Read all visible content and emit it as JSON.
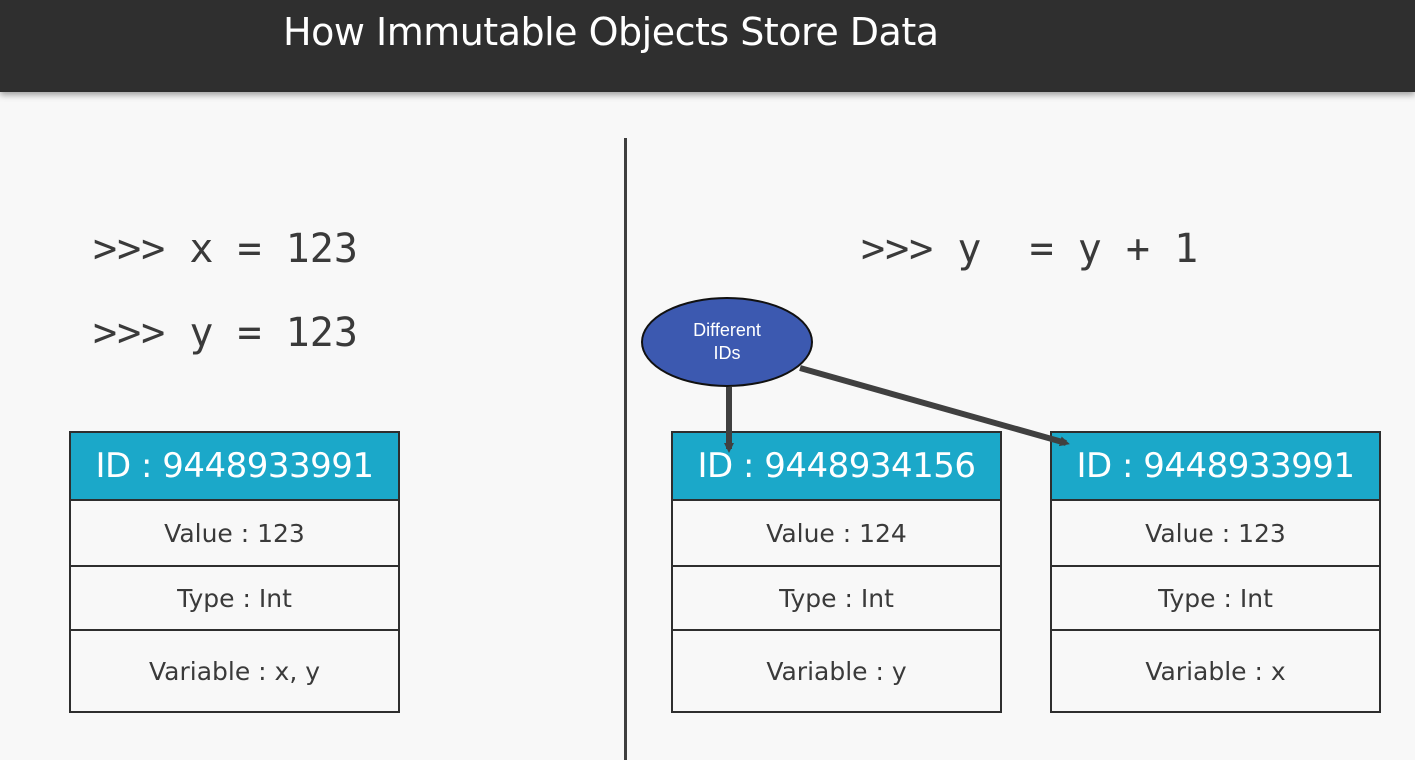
{
  "title": "How Immutable Objects Store Data",
  "left_panel": {
    "code_lines": [
      ">>> x = 123",
      ">>> y = 123"
    ],
    "object": {
      "id": "ID : 9448933991",
      "value": "Value : 123",
      "type": "Type : Int",
      "variable": "Variable : x, y"
    }
  },
  "right_panel": {
    "code_line": ">>> y  = y + 1",
    "callout": {
      "line1": "Different",
      "line2": "IDs",
      "fill_color": "#3c59b0",
      "stroke_color": "#111111"
    },
    "objects": [
      {
        "id": "ID : 9448934156",
        "value": "Value : 124",
        "type": "Type : Int",
        "variable": "Variable : y"
      },
      {
        "id": "ID : 9448933991",
        "value": "Value : 123",
        "type": "Type : Int",
        "variable": "Variable : x"
      }
    ]
  },
  "colors": {
    "header_bg": "#2f2f2f",
    "id_bar": "#1ba8c9",
    "arrow": "#404040"
  }
}
